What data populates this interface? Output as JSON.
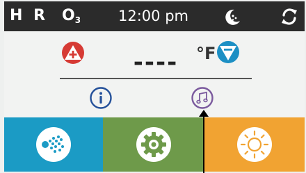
{
  "status": {
    "mode": "H R",
    "ozone": "O",
    "ozone_sub": "3",
    "time": "12:00 pm"
  },
  "icons": {
    "sleep": "moon-stars-icon",
    "sync": "refresh-icon",
    "temp_up": "plus-icon",
    "temp_down": "down-arrow-icon",
    "info": "info-icon",
    "music": "music-note-icon",
    "jets": "jets-icon",
    "settings": "gear-icon",
    "light": "sun-icon"
  },
  "temperature": {
    "value": "----",
    "unit": "°F"
  },
  "colors": {
    "status_bar": "#2b2b2b",
    "up_button": "#d63a34",
    "down_button": "#1c8fc4",
    "jets_tile": "#1b9bc5",
    "settings_tile": "#6e9a4a",
    "light_tile": "#f1a332",
    "info_ring": "#24509a",
    "music_ring": "#7b5a9e"
  }
}
